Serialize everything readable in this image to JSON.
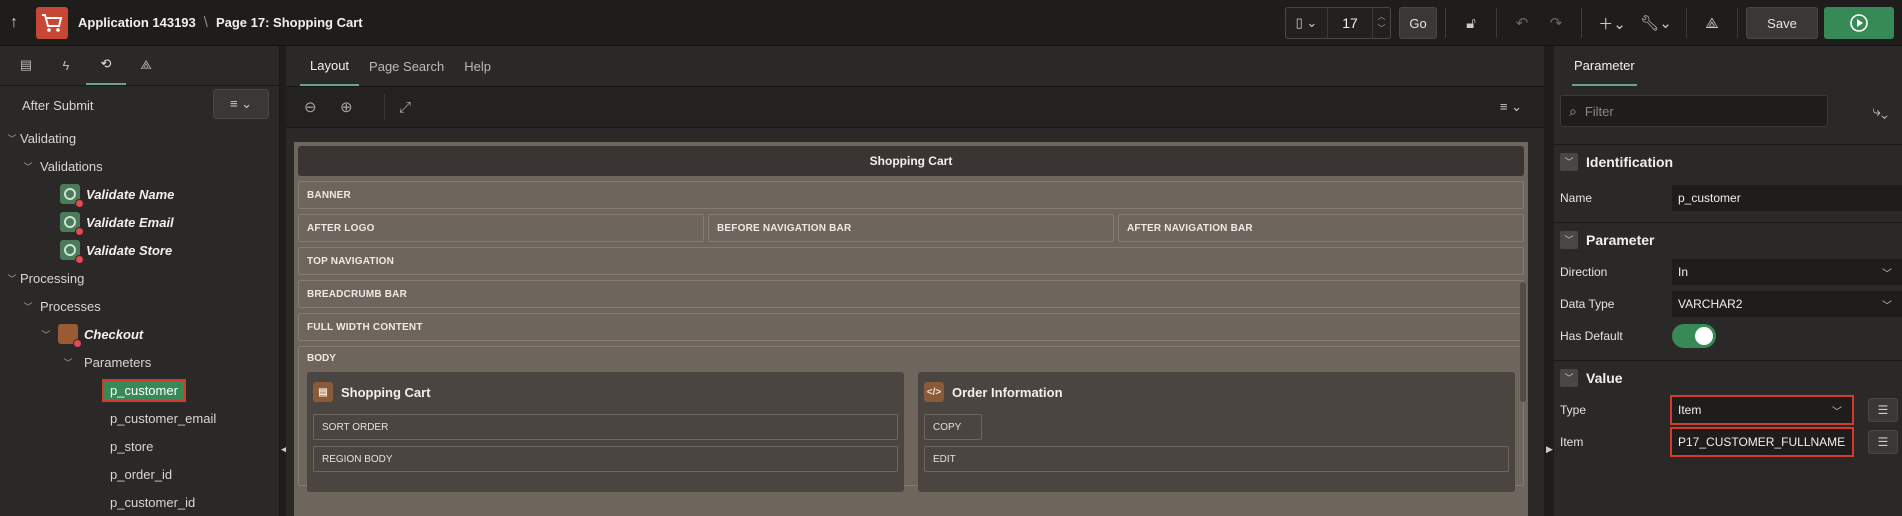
{
  "topbar": {
    "app_name": "Application 143193",
    "separator": "\\",
    "page_name": "Page 17: Shopping Cart",
    "page_number": "17",
    "go_label": "Go",
    "save_label": "Save"
  },
  "left": {
    "heading": "After Submit",
    "tree": {
      "validating": "Validating",
      "validations": "Validations",
      "validate_name": "Validate Name",
      "validate_email": "Validate Email",
      "validate_store": "Validate Store",
      "processing": "Processing",
      "processes": "Processes",
      "checkout": "Checkout",
      "parameters": "Parameters",
      "params": [
        "p_customer",
        "p_customer_email",
        "p_store",
        "p_order_id",
        "p_customer_id"
      ]
    }
  },
  "middle": {
    "tabs": [
      "Layout",
      "Page Search",
      "Help"
    ],
    "page_title": "Shopping Cart",
    "regions": {
      "banner": "BANNER",
      "after_logo": "AFTER LOGO",
      "before_nav": "BEFORE NAVIGATION BAR",
      "after_nav": "AFTER NAVIGATION BAR",
      "top_nav": "TOP NAVIGATION",
      "breadcrumb": "BREADCRUMB BAR",
      "full_width": "FULL WIDTH CONTENT",
      "body": "BODY"
    },
    "cards": {
      "cart_title": "Shopping Cart",
      "cart_sort": "SORT ORDER",
      "cart_region_body": "REGION BODY",
      "order_title": "Order Information",
      "order_copy": "COPY",
      "order_edit": "EDIT"
    }
  },
  "right": {
    "tab": "Parameter",
    "filter_placeholder": "Filter",
    "sections": {
      "identification": "Identification",
      "parameter": "Parameter",
      "value": "Value"
    },
    "props": {
      "name_label": "Name",
      "name_value": "p_customer",
      "direction_label": "Direction",
      "direction_value": "In",
      "datatype_label": "Data Type",
      "datatype_value": "VARCHAR2",
      "hasdefault_label": "Has Default",
      "type_label": "Type",
      "type_value": "Item",
      "item_label": "Item",
      "item_value": "P17_CUSTOMER_FULLNAME"
    }
  },
  "colors": {
    "accent_green": "#378a55",
    "highlight_red": "#d33a2c",
    "brand_red": "#c74634"
  }
}
